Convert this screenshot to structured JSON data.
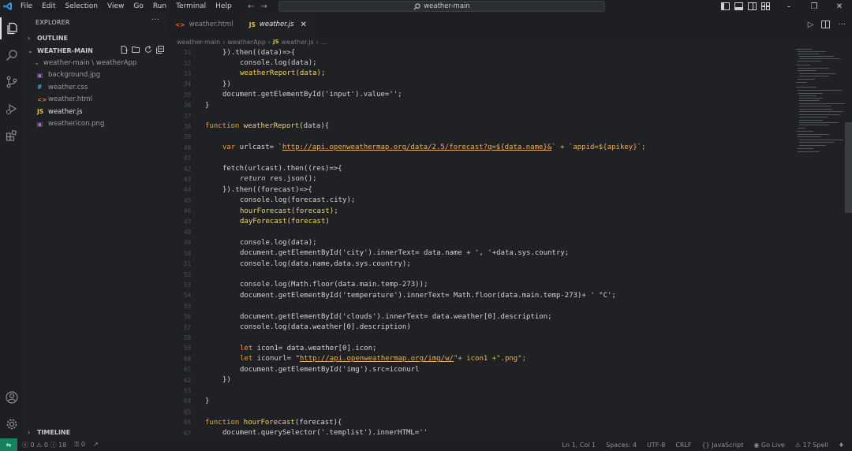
{
  "titlebar": {
    "menu": [
      "File",
      "Edit",
      "Selection",
      "View",
      "Go",
      "Run",
      "Terminal",
      "Help"
    ],
    "search_text": "weather-main"
  },
  "sidebar": {
    "title": "EXPLORER",
    "outline": "OUTLINE",
    "folder": "WEATHER-MAIN",
    "subfolder": "weather-main \\ weatherApp",
    "files": [
      {
        "icon": "image-file-icon",
        "name": "background.jpg"
      },
      {
        "icon": "css-file-icon",
        "name": "weather.css"
      },
      {
        "icon": "html-file-icon",
        "name": "weather.html"
      },
      {
        "icon": "js-file-icon",
        "name": "weather.js"
      },
      {
        "icon": "image-file-icon",
        "name": "weathericon.png"
      }
    ],
    "timeline": "TIMELINE"
  },
  "tabs": [
    {
      "name": "weather.html",
      "active": false
    },
    {
      "name": "weather.js",
      "active": true
    }
  ],
  "breadcrumb": [
    "weather-main",
    "weatherApp",
    "weather.js",
    "..."
  ],
  "code_lines": [
    {
      "n": "31"
    },
    {
      "n": "32"
    },
    {
      "n": "33"
    },
    {
      "n": "34"
    },
    {
      "n": "35"
    },
    {
      "n": "36"
    },
    {
      "n": "37"
    },
    {
      "n": "38"
    },
    {
      "n": "39"
    },
    {
      "n": "40"
    },
    {
      "n": "41"
    },
    {
      "n": "42"
    },
    {
      "n": "43"
    },
    {
      "n": "44"
    },
    {
      "n": "45"
    },
    {
      "n": "46"
    },
    {
      "n": "47"
    },
    {
      "n": "48"
    },
    {
      "n": "49"
    },
    {
      "n": "50"
    },
    {
      "n": "51"
    },
    {
      "n": "52"
    },
    {
      "n": "53"
    },
    {
      "n": "54"
    },
    {
      "n": "55"
    },
    {
      "n": "56"
    },
    {
      "n": "57"
    },
    {
      "n": "58"
    },
    {
      "n": "59"
    },
    {
      "n": "60"
    },
    {
      "n": "61"
    },
    {
      "n": "62"
    },
    {
      "n": "63"
    },
    {
      "n": "64"
    },
    {
      "n": "65"
    },
    {
      "n": "66"
    },
    {
      "n": "67"
    }
  ],
  "code": {
    "l31": "}).then((data)=>{",
    "l32": "console.log(data);",
    "l33": "weatherReport(data);",
    "l34": "})",
    "l35": "document.getElementById('input').value='';",
    "l36": "}",
    "l38_kw": "function",
    "l38_name": "weatherReport",
    "l38_rest": "(data){",
    "l40_kw": "var",
    "l40_a": " urlcast= `",
    "l40_url": "http://api.openweathermap.org/data/2.5/forecast?q=${data.name}&",
    "l40_b": "` + `appid=${apikey}`;",
    "l42": "fetch(urlcast).then((res)=>{",
    "l43_kw": "return",
    "l43_rest": " res.json();",
    "l44": "}).then((forecast)=>{",
    "l45": "console.log(forecast.city);",
    "l46": "hourForecast(forecast);",
    "l47": "dayForecast(forecast)",
    "l49": "console.log(data);",
    "l50": "document.getElementById('city').innerText= data.name + ', '+data.sys.country;",
    "l51": "console.log(data.name,data.sys.country);",
    "l53": "console.log(Math.floor(data.main.temp-273));",
    "l54": "document.getElementById('temperature').innerText= Math.floor(data.main.temp-273)+ ' °C';",
    "l56": "document.getElementById('clouds').innerText= data.weather[0].description;",
    "l57": "console.log(data.weather[0].description)",
    "l59_kw": "let",
    "l59_rest": " icon1= data.weather[0].icon;",
    "l60_kw": "let",
    "l60_a": " iconurl= \"",
    "l60_url": "http://api.openweathermap.org/img/w/",
    "l60_b": "\"+ icon1 +\".png\";",
    "l61": "document.getElementById('img').src=iconurl",
    "l62": "})",
    "l64": "}",
    "l66_kw": "function",
    "l66_name": "hourForecast",
    "l66_rest": "(forecast){",
    "l67": "document.querySelector('.templist').innerHTML=''"
  },
  "statusbar": {
    "problems": "ⓧ 0 ⚠ 0 ⓘ 18",
    "ports": "⚿ 0",
    "position": "Ln 1, Col 1",
    "spaces": "Spaces: 4",
    "encoding": "UTF-8",
    "eol": "CRLF",
    "language": "{} JavaScript",
    "golive": "Go Live",
    "spell": "⚠ 17 Spell"
  },
  "colors": {
    "remote": "#16825d",
    "background": "#1f2124"
  }
}
